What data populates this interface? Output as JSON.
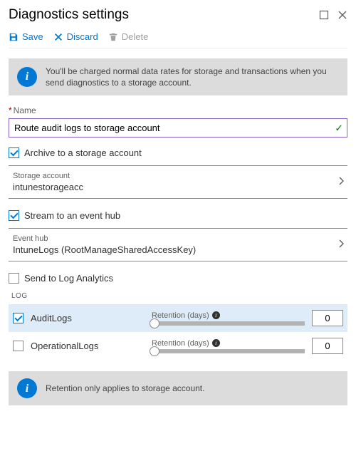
{
  "header": {
    "title": "Diagnostics settings"
  },
  "toolbar": {
    "save_label": "Save",
    "discard_label": "Discard",
    "delete_label": "Delete"
  },
  "info_top": "You'll be charged normal data rates for storage and transactions when you send diagnostics to a storage account.",
  "name_field": {
    "label": "Name",
    "value": "Route audit logs to storage account"
  },
  "archive": {
    "label": "Archive to a storage account",
    "checked": true
  },
  "storage_picker": {
    "label": "Storage account",
    "value": "intunestorageacc"
  },
  "stream": {
    "label": "Stream to an event hub",
    "checked": true
  },
  "eventhub_picker": {
    "label": "Event hub",
    "value": "IntuneLogs (RootManageSharedAccessKey)"
  },
  "log_analytics": {
    "label": "Send to Log Analytics",
    "checked": false
  },
  "log_section_label": "LOG",
  "retention_label": "Retention (days)",
  "logs": [
    {
      "name": "AuditLogs",
      "checked": true,
      "retention": "0",
      "selected": true
    },
    {
      "name": "OperationalLogs",
      "checked": false,
      "retention": "0",
      "selected": false
    }
  ],
  "info_bottom": "Retention only applies to storage account."
}
